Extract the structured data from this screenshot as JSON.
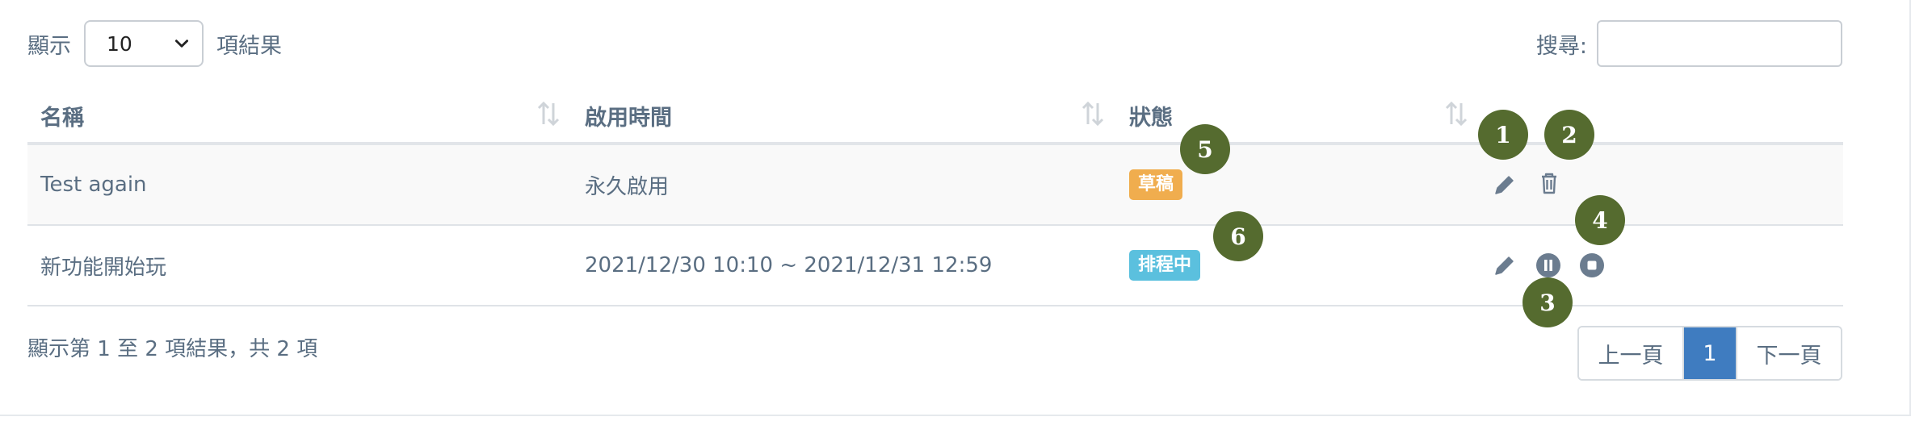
{
  "length_menu": {
    "show_label": "顯示",
    "selected": "10",
    "suffix_label": "項結果"
  },
  "search": {
    "label": "搜尋:",
    "value": ""
  },
  "table": {
    "columns": [
      "名稱",
      "啟用時間",
      "狀態"
    ],
    "rows": [
      {
        "name": "Test again",
        "time": "永久啟用",
        "status": "草稿",
        "status_color": "#f0ad4e"
      },
      {
        "name": "新功能開始玩",
        "time": "2021/12/30 10:10 ~ 2021/12/31 12:59",
        "status": "排程中",
        "status_color": "#5bc0de"
      }
    ]
  },
  "footer": {
    "info": "顯示第 1 至 2 項結果，共 2 項"
  },
  "pagination": {
    "prev": "上一頁",
    "current": "1",
    "next": "下一頁"
  },
  "markers": [
    "1",
    "2",
    "3",
    "4",
    "5",
    "6"
  ],
  "colors": {
    "marker": "#556b2f",
    "page_active": "#3f7cc0"
  }
}
